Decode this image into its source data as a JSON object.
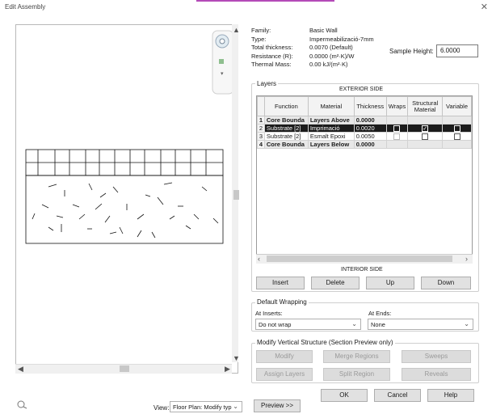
{
  "window": {
    "title": "Edit Assembly",
    "close_glyph": "✕"
  },
  "properties": {
    "family_label": "Family:",
    "family_value": "Basic Wall",
    "type_label": "Type:",
    "type_value": "Impermeabilizació-7mm",
    "thickness_label": "Total thickness:",
    "thickness_value": "0.0070 (Default)",
    "resistance_label": "Resistance (R):",
    "resistance_value": "0.0000 (m²·K)/W",
    "mass_label": "Thermal Mass:",
    "mass_value": "0.00 kJ/(m²·K)",
    "sample_height_label": "Sample Height:",
    "sample_height_value": "6.0000"
  },
  "layers": {
    "group_label": "Layers",
    "exterior_side": "EXTERIOR SIDE",
    "interior_side": "INTERIOR SIDE",
    "columns": [
      "Function",
      "Material",
      "Thickness",
      "Wraps",
      "Structural Material",
      "Variable"
    ],
    "rows": [
      {
        "idx": "1",
        "function": "Core Bounda",
        "material": "Layers Above",
        "thickness": "0.0000",
        "style": "bold"
      },
      {
        "idx": "2",
        "function": "Substrate [2]",
        "material": "Imprimació",
        "thickness": "0.0020",
        "style": "sel"
      },
      {
        "idx": "3",
        "function": "Substrate [2]",
        "material": "Esmalt Epoxi",
        "thickness": "0.0050",
        "style": ""
      },
      {
        "idx": "4",
        "function": "Core Bounda",
        "material": "Layers Below",
        "thickness": "0.0000",
        "style": "bold"
      }
    ],
    "buttons": {
      "insert": "Insert",
      "delete": "Delete",
      "up": "Up",
      "down": "Down"
    }
  },
  "default_wrapping": {
    "group_label": "Default Wrapping",
    "at_inserts_label": "At Inserts:",
    "at_inserts_value": "Do not wrap",
    "at_ends_label": "At Ends:",
    "at_ends_value": "None"
  },
  "modify_structure": {
    "group_label": "Modify Vertical Structure (Section Preview only)",
    "buttons": [
      "Modify",
      "Merge Regions",
      "Sweeps",
      "Assign Layers",
      "Split Region",
      "Reveals"
    ]
  },
  "footer": {
    "view_label": "View:",
    "view_value": "Floor Plan: Modify typ",
    "preview_button": "Preview >>",
    "ok": "OK",
    "cancel": "Cancel",
    "help": "Help"
  },
  "icons": [
    "close-icon",
    "navigation-wheel-icon",
    "zoom-icon",
    "chevron-down-icon",
    "help-icon"
  ],
  "colors": {
    "selection": "#1b1b1b",
    "accent": "#b44ab8"
  }
}
